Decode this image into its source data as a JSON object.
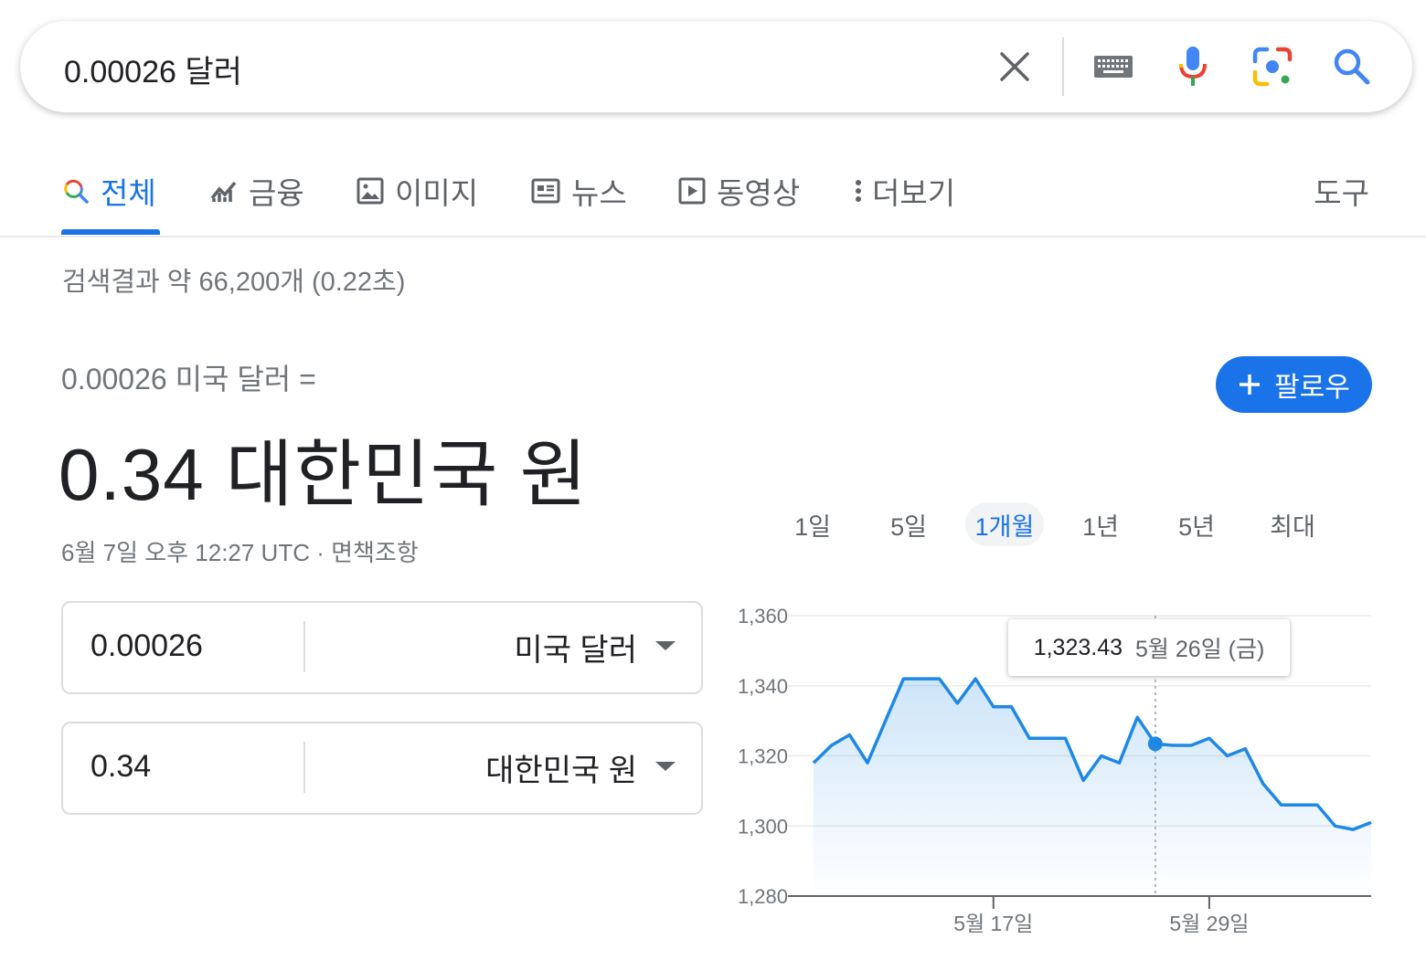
{
  "search": {
    "query": "0.00026 달러"
  },
  "tabs": [
    {
      "label": "전체"
    },
    {
      "label": "금융"
    },
    {
      "label": "이미지"
    },
    {
      "label": "뉴스"
    },
    {
      "label": "동영상"
    },
    {
      "label": "더보기"
    }
  ],
  "tools_label": "도구",
  "result_stats": "검색결과 약 66,200개 (0.22초)",
  "converter": {
    "source_line": "0.00026 미국 달러 =",
    "result": "0.34 대한민국 원",
    "timestamp": "6월 7일 오후 12:27 UTC · ",
    "disclaimer": "면책조항",
    "follow_label": "팔로우",
    "from": {
      "value": "0.00026",
      "currency": "미국 달러"
    },
    "to": {
      "value": "0.34",
      "currency": "대한민국 원"
    }
  },
  "ranges": [
    "1일",
    "5일",
    "1개월",
    "1년",
    "5년",
    "최대"
  ],
  "active_range": "1개월",
  "tooltip": {
    "value": "1,323.43",
    "date": "5월 26일 (금)"
  },
  "colors": {
    "accent": "#1a73e8",
    "line": "#1e88e5"
  },
  "chart_data": {
    "type": "area",
    "ylim": [
      1280,
      1360
    ],
    "yticks": [
      "1,360",
      "1,340",
      "1,320",
      "1,300",
      "1,280"
    ],
    "ytick_values": [
      1360,
      1340,
      1320,
      1300,
      1280
    ],
    "xtick_labels": [
      "5월 17일",
      "5월 29일"
    ],
    "xtick_index": [
      10,
      22
    ],
    "highlight_index": 19,
    "values": [
      1318,
      1323,
      1326,
      1318,
      1330,
      1342,
      1342,
      1342,
      1335,
      1342,
      1334,
      1334,
      1325,
      1325,
      1325,
      1313,
      1320,
      1318,
      1331,
      1323.43,
      1323,
      1323,
      1325,
      1320,
      1322,
      1312,
      1306,
      1306,
      1306,
      1300,
      1299,
      1301
    ],
    "grid": true,
    "legend": "none"
  }
}
